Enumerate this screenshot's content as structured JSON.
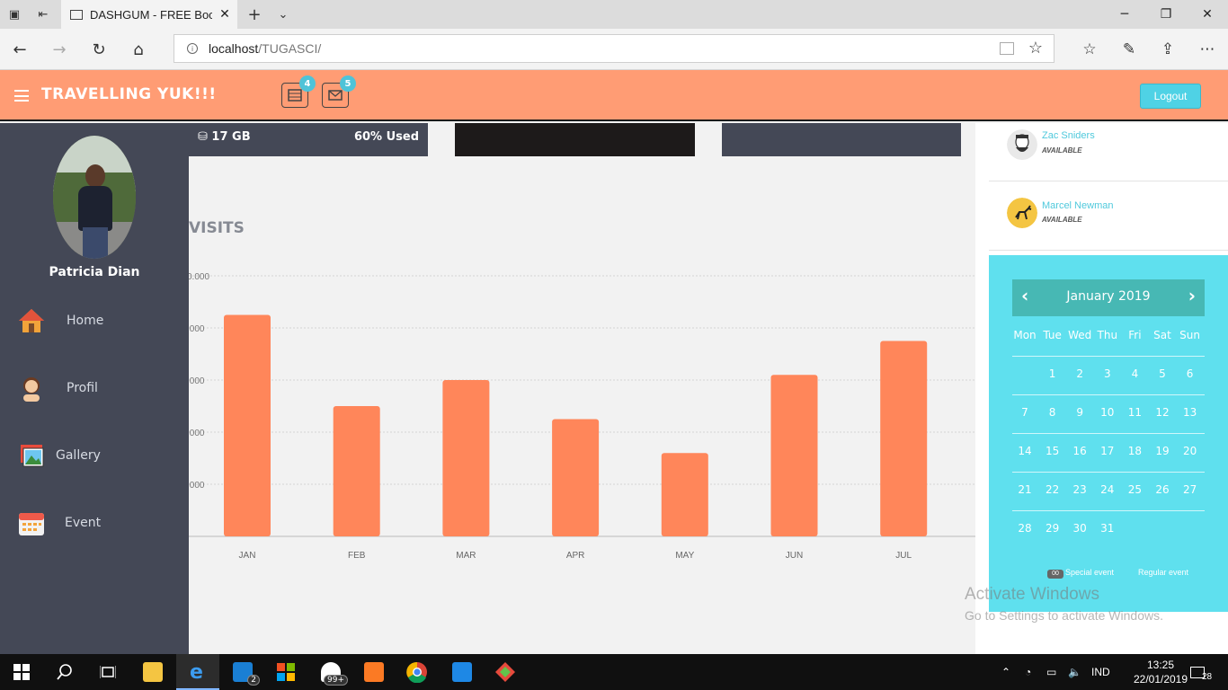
{
  "browser": {
    "tab_title": "DASHGUM - FREE Boot:",
    "url_host": "localhost",
    "url_path": "/TUGASCI/"
  },
  "header": {
    "brand": "TRAVELLING YUK!!!",
    "tasks_badge": "4",
    "messages_badge": "5",
    "logout_label": "Logout"
  },
  "sidebar": {
    "user_name": "Patricia Dian",
    "items": [
      {
        "label": "Home",
        "icon": "house-icon"
      },
      {
        "label": "Profil",
        "icon": "person-icon"
      },
      {
        "label": "Gallery",
        "icon": "picture-icon"
      },
      {
        "label": "Event",
        "icon": "calendar-icon"
      }
    ]
  },
  "panels": {
    "storage_size": "17 GB",
    "storage_used": "60% Used"
  },
  "visits": {
    "title": "VISITS"
  },
  "chart_data": {
    "type": "bar",
    "title": "VISITS",
    "categories": [
      "JAN",
      "FEB",
      "MAR",
      "APR",
      "MAY",
      "JUN",
      "JUL"
    ],
    "values": [
      8500,
      5000,
      6000,
      4500,
      3200,
      6200,
      7500
    ],
    "ytick_labels": [
      "0.000",
      ".000",
      ".000",
      ".000",
      ".000",
      ""
    ],
    "ylim": [
      0,
      10000
    ],
    "grid": true,
    "color": "#ff865a"
  },
  "contacts": [
    {
      "name": "Zac Sniders",
      "status": "AVAILABLE"
    },
    {
      "name": "Marcel Newman",
      "status": "AVAILABLE"
    }
  ],
  "calendar": {
    "month": "January 2019",
    "weekdays": [
      "Mon",
      "Tue",
      "Wed",
      "Thu",
      "Fri",
      "Sat",
      "Sun"
    ],
    "weeks": [
      [
        "",
        "1",
        "2",
        "3",
        "4",
        "5",
        "6"
      ],
      [
        "7",
        "8",
        "9",
        "10",
        "11",
        "12",
        "13"
      ],
      [
        "14",
        "15",
        "16",
        "17",
        "18",
        "19",
        "20"
      ],
      [
        "21",
        "22",
        "23",
        "24",
        "25",
        "26",
        "27"
      ],
      [
        "28",
        "29",
        "30",
        "31",
        "",
        "",
        ""
      ]
    ],
    "legend_swatch": "00",
    "legend_special": "Special event",
    "legend_regular": "Regular event"
  },
  "watermark": {
    "line1": "Activate Windows",
    "line2": "Go to Settings to activate Windows."
  },
  "taskbar": {
    "mail_badge": "2",
    "store_badge": "99+",
    "language": "IND",
    "time": "13:25",
    "date": "22/01/2019",
    "notifications": "28"
  },
  "colors": {
    "header": "#ff9c74",
    "sidebar": "#444856",
    "bar": "#ff865a",
    "calendar": "#5fe0ee",
    "calendar_header": "#47b8b4"
  }
}
